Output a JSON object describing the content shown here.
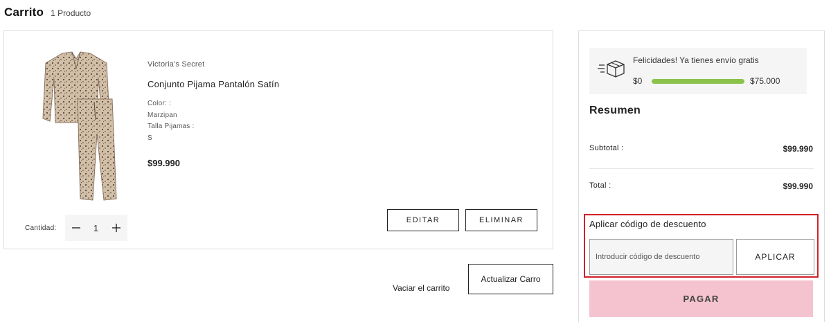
{
  "header": {
    "title": "Carrito",
    "item_count": "1 Producto"
  },
  "product": {
    "brand": "Victoria's Secret",
    "name": "Conjunto Pijama Pantalón Satín",
    "attributes": [
      "Color:  :",
      "Marzipan",
      "Talla Pijamas  :",
      "S"
    ],
    "price": "$99.990",
    "quantity_label": "Cantidad:",
    "quantity": "1",
    "edit_label": "EDITAR",
    "delete_label": "ELIMINAR"
  },
  "cart_actions": {
    "empty_label": "Vaciar el carrito",
    "update_label": "Actualizar Carro"
  },
  "shipping": {
    "message": "Felicidades! Ya tienes envío gratis",
    "min_label": "$0",
    "max_label": "$75.000",
    "progress_percent": 100,
    "bar_color": "#8bc34a"
  },
  "summary": {
    "title": "Resumen",
    "subtotal_label": "Subtotal :",
    "subtotal_value": "$99.990",
    "total_label": "Total :",
    "total_value": "$99.990"
  },
  "discount": {
    "title": "Aplicar código de descuento",
    "placeholder": "Introducir código de descuento",
    "value": "",
    "apply_label": "APLICAR",
    "highlight_color": "#d32027"
  },
  "checkout": {
    "pay_label": "PAGAR",
    "pay_color": "#f4c3cf"
  },
  "icons": [
    "fast-delivery-box-icon",
    "minus-icon",
    "plus-icon"
  ]
}
